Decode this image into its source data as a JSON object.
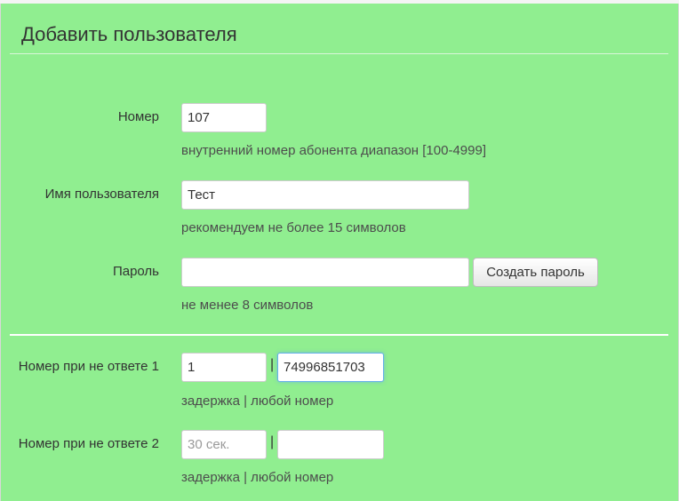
{
  "header": {
    "title": "Добавить пользователя"
  },
  "form": {
    "number": {
      "label": "Номер",
      "value": "107",
      "help": "внутренний номер абонента диапазон [100-4999]"
    },
    "username": {
      "label": "Имя пользователя",
      "value": "Тест",
      "help": "рекомендуем не более 15 символов"
    },
    "password": {
      "label": "Пароль",
      "value": "",
      "generate_button": "Создать пароль",
      "help": "не менее 8 символов"
    },
    "noanswer1": {
      "label": "Номер при не ответе 1",
      "delay_value": "1",
      "separator": "|",
      "number_value": "74996851703",
      "help": "задержка | любой номер"
    },
    "noanswer2": {
      "label": "Номер при не ответе 2",
      "delay_value": "",
      "delay_placeholder": "30 сек.",
      "separator": "|",
      "number_value": "",
      "help": "задержка | любой номер"
    }
  },
  "colors": {
    "panel_background": "#90ee90",
    "focus_border": "#66afe9"
  }
}
